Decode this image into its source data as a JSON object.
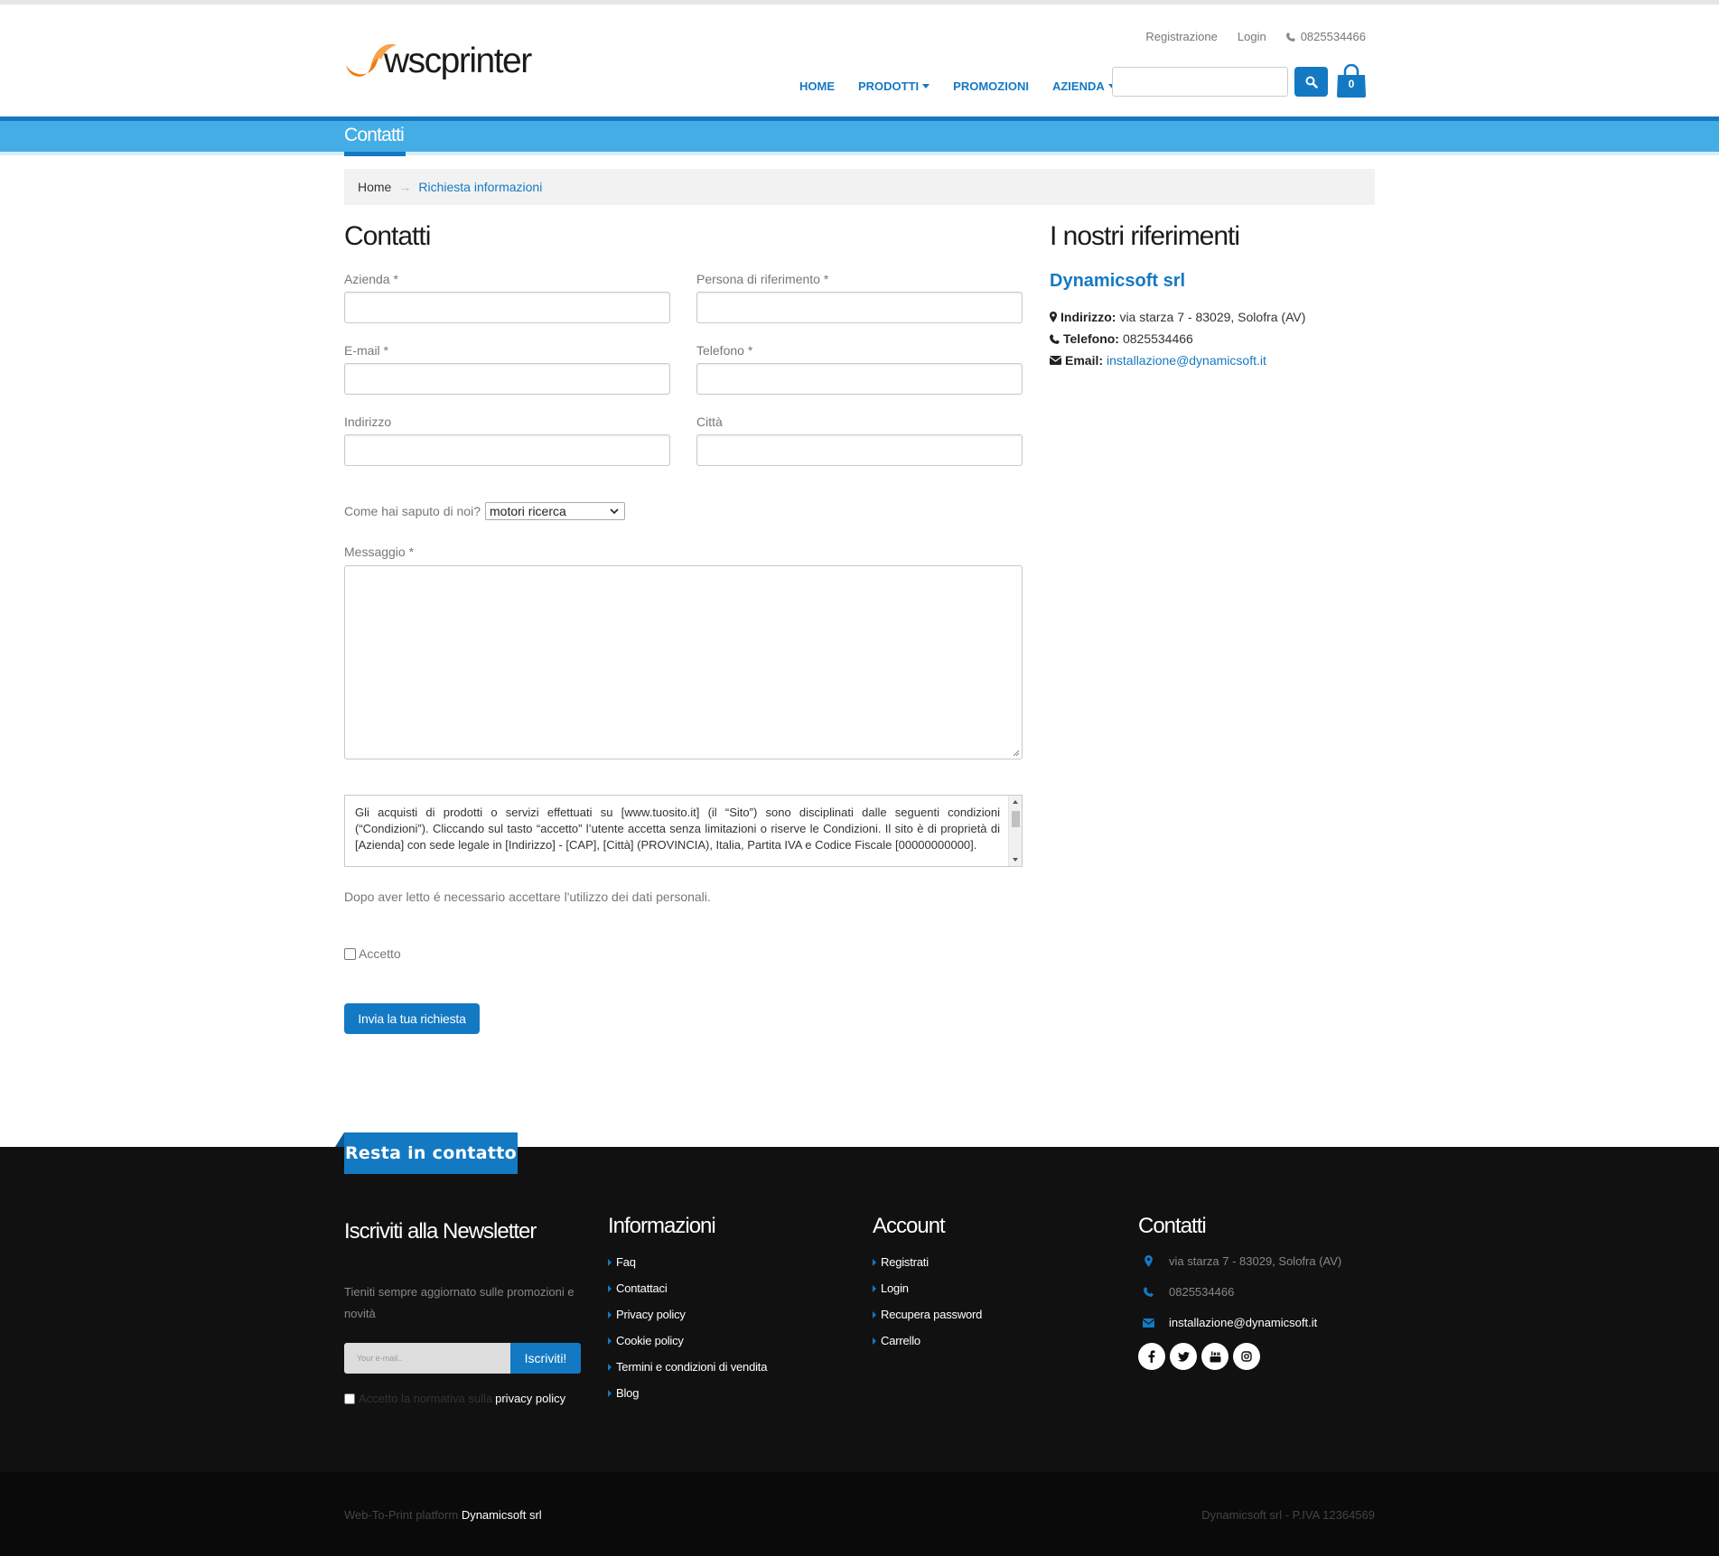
{
  "brand": {
    "logo_text": "wscprinter",
    "accent_color": "#1479c3",
    "logo_color": "#f07a12"
  },
  "toplinks": {
    "register": "Registrazione",
    "login": "Login",
    "phone": "0825534466"
  },
  "nav": {
    "home": "HOME",
    "products": "PRODOTTI",
    "promotions": "PROMOZIONI",
    "company": "AZIENDA"
  },
  "search": {
    "value": "",
    "icon": "search-icon"
  },
  "cart": {
    "count": "0",
    "icon": "shopping-bag-icon"
  },
  "page_title": "Contatti",
  "breadcrumb": {
    "home": "Home",
    "current": "Richiesta informazioni"
  },
  "form": {
    "heading": "Contatti",
    "azienda_label": "Azienda *",
    "persona_label": "Persona di riferimento *",
    "email_label": "E-mail *",
    "telefono_label": "Telefono *",
    "indirizzo_label": "Indirizzo",
    "citta_label": "Città",
    "source_label": "Come hai saputo di noi?",
    "source_value": "motori ricerca",
    "message_label": "Messaggio *",
    "terms_text": "Gli acquisti di prodotti o servizi effettuati su [www.tuosito.it] (il “Sito”) sono disciplinati dalle seguenti condizioni (“Condizioni”). Cliccando sul tasto “accetto” l’utente accetta senza limitazioni o riserve le Condizioni. Il sito è di proprietà di [Azienda] con sede legale in [Indirizzo] - [CAP], [Città] (PROVINCIA), Italia, Partita IVA e Codice Fiscale [00000000000].",
    "notice": "Dopo aver letto é necessario accettare l'utilizzo dei dati personali.",
    "accept_label": "Accetto",
    "submit": "Invia la tua richiesta"
  },
  "references": {
    "heading": "I nostri riferimenti",
    "company": "Dynamicsoft srl",
    "address_label": "Indirizzo:",
    "address": "via starza 7 - 83029, Solofra (AV)",
    "phone_label": "Telefono:",
    "phone": "0825534466",
    "email_label": "Email:",
    "email": "installazione@dynamicsoft.it"
  },
  "footer": {
    "tag": "Resta in contatto",
    "newsletter_heading": "Iscriviti alla Newsletter",
    "newsletter_text": "Tieniti sempre aggiornato sulle promozioni e novità",
    "newsletter_placeholder": "Your e-mail..",
    "newsletter_button": "Iscriviti!",
    "privacy_prefix": "Accetto la normativa sulla",
    "privacy_link": "privacy policy",
    "info_heading": "Informazioni",
    "info_links": [
      "Faq",
      "Contattaci",
      "Privacy policy",
      "Cookie policy",
      "Termini e condizioni di vendita",
      "Blog"
    ],
    "account_heading": "Account",
    "account_links": [
      "Registrati",
      "Login",
      "Recupera password",
      "Carrello"
    ],
    "contacts_heading": "Contatti",
    "address": "via starza 7 - 83029, Solofra (AV)",
    "phone": "0825534466",
    "email": "installazione@dynamicsoft.it",
    "social": [
      "facebook-icon",
      "twitter-icon",
      "youtube-icon",
      "instagram-icon"
    ]
  },
  "bottom": {
    "platform_prefix": "Web-To-Print platform",
    "platform_company": "Dynamicsoft srl",
    "vat": "Dynamicsoft srl - P.IVA 12364569"
  }
}
